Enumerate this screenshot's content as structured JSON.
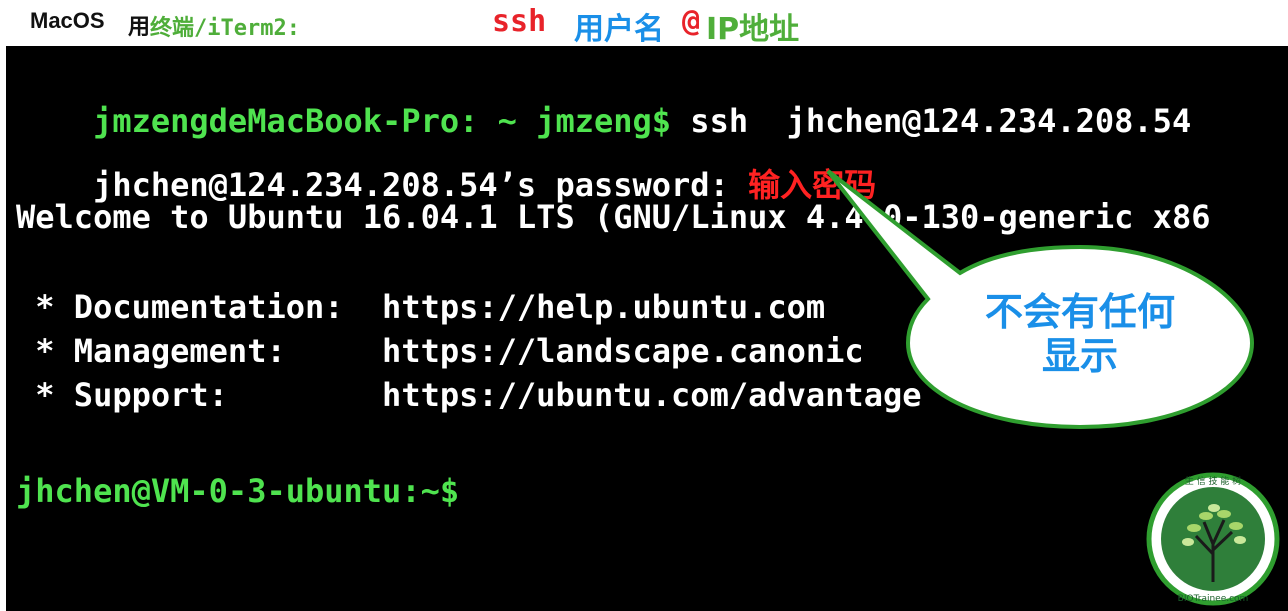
{
  "caption": {
    "prefix": "MacOS",
    "prefix_cn": "用",
    "terminal_name": "终端/iTerm2:",
    "ssh": "ssh",
    "user": "用户名",
    "at": "@",
    "ip": "IP地址"
  },
  "terminal": {
    "line1_prompt": "jmzengdeMacBook-Pro: ~ jmzeng$",
    "line1_cmd": " ssh  jhchen@124.234.208.54",
    "line2_text": "jhchen@124.234.208.54’s password: ",
    "line2_hint": "输入密码",
    "line3": "Welcome to Ubuntu 16.04.1 LTS (GNU/Linux 4.4.0-130-generic x86",
    "doc_line": " * Documentation:  https://help.ubuntu.com",
    "mgmt_line": " * Management:     https://landscape.canonic",
    "support_line": " * Support:        https://ubuntu.com/advantage",
    "final_prompt": "jhchen@VM-0-3-ubuntu:~$"
  },
  "callout": {
    "text_line1": "不会有任何",
    "text_line2": "显示"
  },
  "logo": {
    "top_text": "生 信 技 能 树",
    "bottom_text": "BIOTrainee.com"
  },
  "colors": {
    "terminal_bg": "#000000",
    "prompt_green": "#4fe34f",
    "hint_red": "#ff2222",
    "callout_blue": "#1a8fe8",
    "callout_border": "#2f9e2f"
  }
}
